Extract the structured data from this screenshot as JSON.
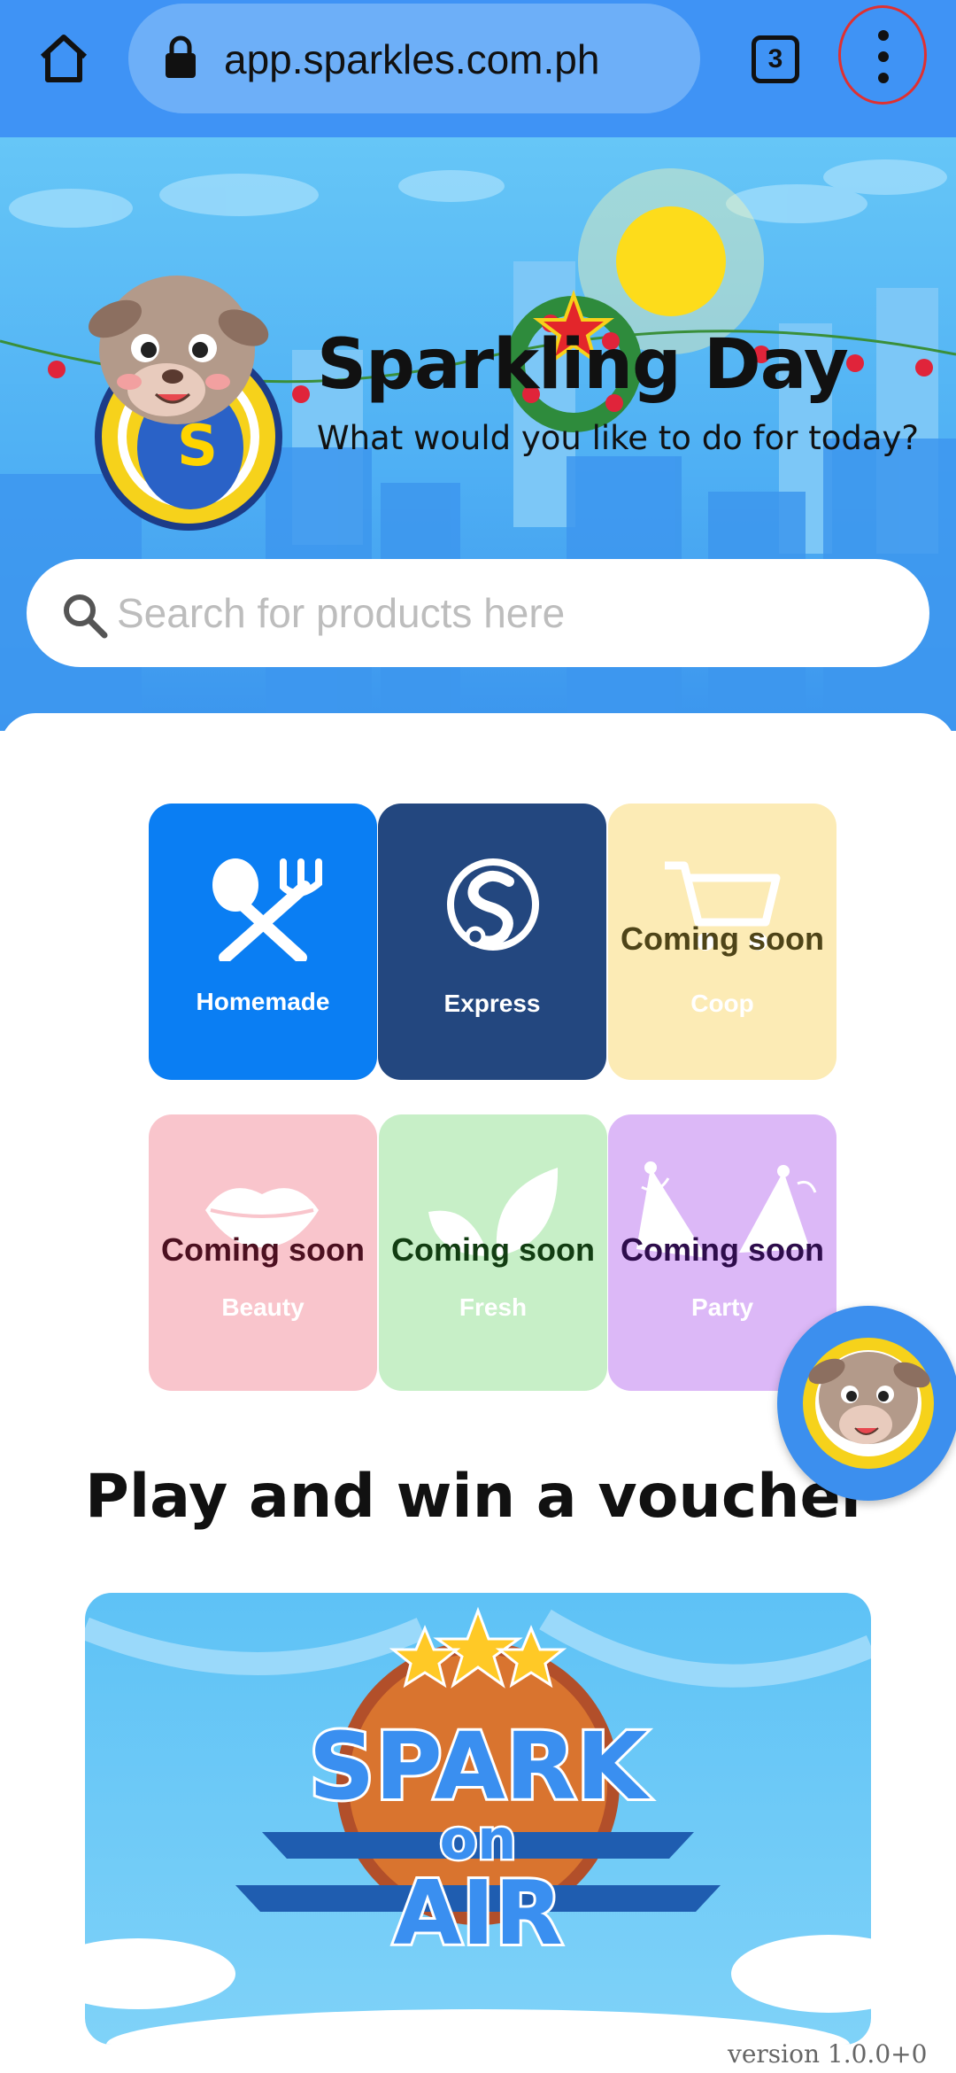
{
  "browser": {
    "url": "app.sparkles.com.ph",
    "tab_count": "3"
  },
  "hero": {
    "title": "Sparkling Day",
    "subtitle": "What would you like to do for today?"
  },
  "search": {
    "placeholder": "Search for products here"
  },
  "categories": [
    {
      "label": "Homemade",
      "status": "",
      "color": "#0a7ef3",
      "icon": "fork-spoon-icon"
    },
    {
      "label": "Express",
      "status": "",
      "color": "#23477f",
      "icon": "sparkles-s-icon"
    },
    {
      "label": "Coop",
      "status": "Coming soon",
      "color": "#fcebb5",
      "icon": "cart-icon"
    },
    {
      "label": "Beauty",
      "status": "Coming soon",
      "color": "#f9c5cc",
      "icon": "lips-icon"
    },
    {
      "label": "Fresh",
      "status": "Coming soon",
      "color": "#c7efc7",
      "icon": "leaf-icon"
    },
    {
      "label": "Party",
      "status": "Coming soon",
      "color": "#dcb8f7",
      "icon": "party-hat-icon"
    }
  ],
  "promo": {
    "section_title": "Play and win a voucher",
    "banner_line1": "SPARK",
    "banner_line2": "on",
    "banner_line3": "AIR"
  },
  "footer": {
    "version": "version 1.0.0+0"
  }
}
